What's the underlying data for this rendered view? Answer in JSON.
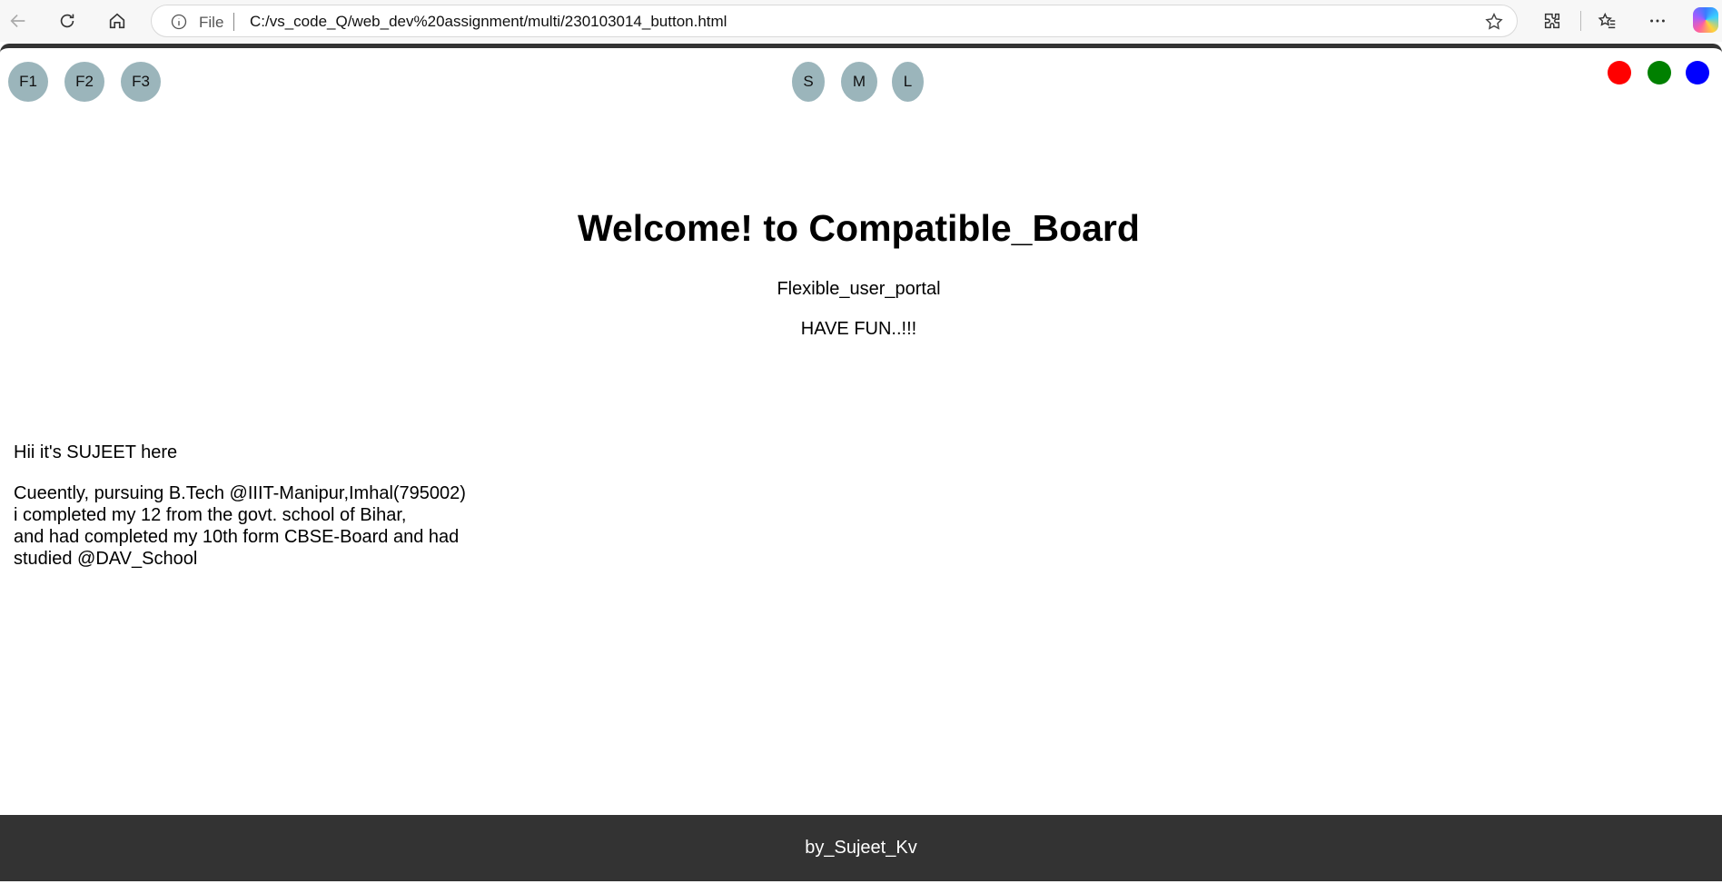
{
  "browser": {
    "url_scheme_label": "File",
    "url": "C:/vs_code_Q/web_dev%20assignment/multi/230103014_button.html"
  },
  "font_buttons": [
    "F1",
    "F2",
    "F3"
  ],
  "size_buttons": [
    "S",
    "M",
    "L"
  ],
  "color_dots": [
    "#ff0000",
    "#008000",
    "#0000ff"
  ],
  "main": {
    "title": "Welcome! to Compatible_Board",
    "subtitle": "Flexible_user_portal",
    "tagline": "HAVE FUN..!!!"
  },
  "about": {
    "intro": "Hii it's SUJEET here",
    "lines": [
      "Cueently, pursuing B.Tech @IIIT-Manipur,Imhal(795002)",
      "i completed my 12 from the govt. school of Bihar,",
      "and had completed my 10th form CBSE-Board and had",
      "studied @DAV_School"
    ]
  },
  "footer": {
    "text": "by_Sujeet_Kv"
  }
}
